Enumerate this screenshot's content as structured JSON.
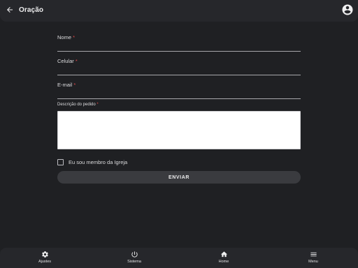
{
  "header": {
    "title": "Oração",
    "back_icon": "arrow-left-icon",
    "account_icon": "account-circle-icon"
  },
  "form": {
    "fields": [
      {
        "label": "Nome",
        "required_mark": "*"
      },
      {
        "label": "Celular",
        "required_mark": "*"
      },
      {
        "label": "E-mail",
        "required_mark": "*"
      }
    ],
    "description_label": "Descrição do pedido",
    "description_required_mark": "*",
    "description_value": "",
    "member_checkbox_label": "Eu sou membro da Igreja",
    "member_checkbox_checked": false,
    "submit_label": "ENVIAR"
  },
  "bottom_nav": {
    "items": [
      {
        "label": "Ajustes",
        "icon": "gear-icon"
      },
      {
        "label": "Sistema",
        "icon": "power-icon"
      },
      {
        "label": "Home",
        "icon": "home-icon"
      },
      {
        "label": "Menu",
        "icon": "menu-icon"
      }
    ]
  },
  "colors": {
    "background": "#1f2023",
    "bar": "#26272b",
    "required": "#e0494a",
    "button": "#3a3b3f"
  }
}
